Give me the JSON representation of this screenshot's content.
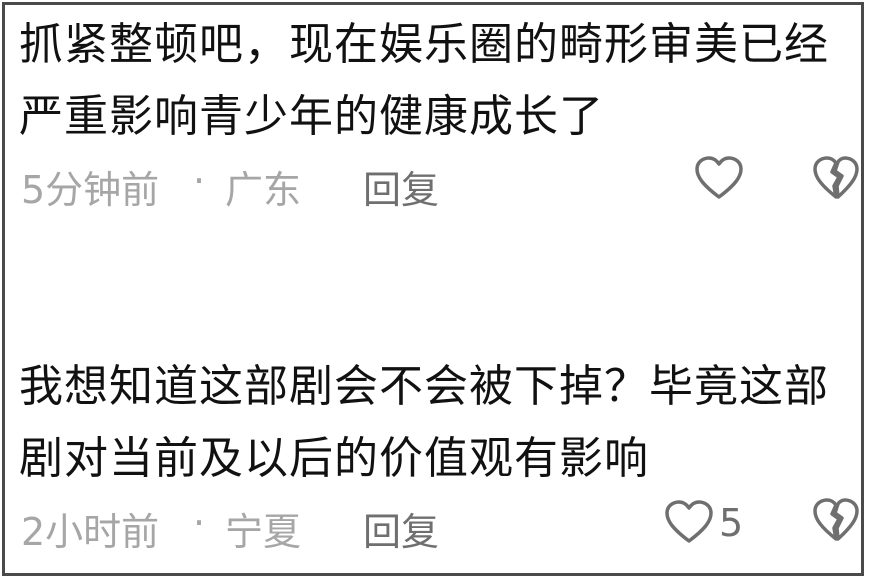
{
  "comments": [
    {
      "text": "抓紧整顿吧，现在娱乐圈的畸形审美已经严重影响青少年的健康成长了",
      "time": "5分钟前",
      "separator": "·",
      "location": "广东",
      "reply_label": "回复",
      "like_icon": "heart-outline-icon",
      "dislike_icon": "broken-heart-icon"
    },
    {
      "text": "我想知道这部剧会不会被下掉？毕竟这部剧对当前及以后的价值观有影响",
      "time": "2小时前",
      "separator": "·",
      "location": "宁夏",
      "reply_label": "回复",
      "like_count": "5",
      "like_icon": "heart-outline-icon",
      "dislike_icon": "broken-heart-icon"
    }
  ],
  "colors": {
    "text": "#111111",
    "meta": "#a6a6a6",
    "action": "#6f6f6f",
    "border": "#4a4a4a"
  }
}
